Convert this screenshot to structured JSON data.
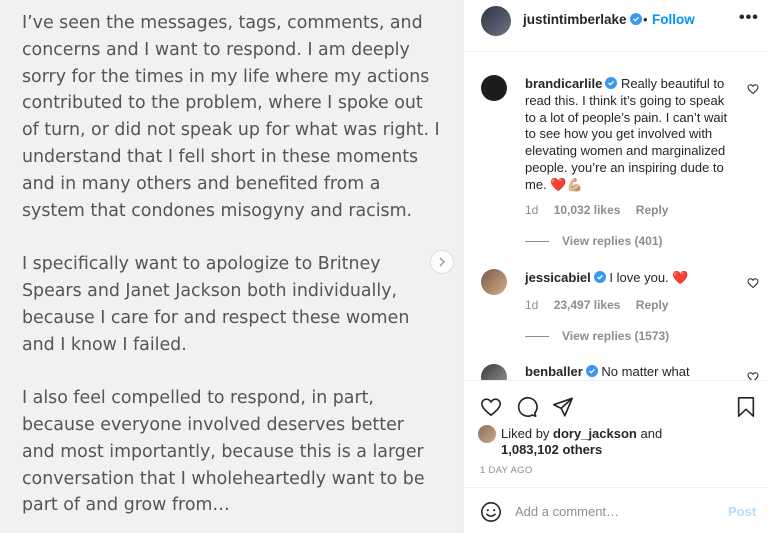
{
  "post": {
    "paragraphs": [
      "I’ve seen the messages, tags, comments, and concerns and I want to respond. I am deeply sorry for the times in my life where my actions contributed to the problem, where I spoke out of turn, or did not speak up for what was right. I understand that I fell short in these moments and in many others and benefited from a system that condones misogyny and racism.",
      "I specifically want to apologize to Britney Spears and Janet Jackson both individually, because I care for and respect these women and I know I failed.",
      "I also feel compelled to respond, in part, because everyone involved deserves better and most importantly, because this is a larger conversation that I wholeheartedly want to be part of and grow from…"
    ]
  },
  "header": {
    "username": "justintimberlake",
    "separator": "•",
    "follow_label": "Follow",
    "more_label": "•••"
  },
  "comments": [
    {
      "username": "brandicarlile",
      "text": "Really beautiful to read this. I think it’s going to speak to a lot of people’s pain. I can’t wait to see how you get involved with elevating women and marginalized people. you’re an inspiring dude to me. ❤️💪🏼",
      "age": "1d",
      "likes": "10,032 likes",
      "reply": "Reply",
      "view_replies": "View replies (401)"
    },
    {
      "username": "jessicabiel",
      "text": "I love you. ❤️",
      "age": "1d",
      "likes": "23,497 likes",
      "reply": "Reply",
      "view_replies": "View replies (1573)"
    },
    {
      "username": "benballer",
      "text": "No matter what"
    }
  ],
  "likes": {
    "prefix": "Liked by",
    "user": "dory_jackson",
    "conj": "and",
    "others": "1,083,102 others"
  },
  "timestamp": "1 DAY AGO",
  "comment_box": {
    "placeholder": "Add a comment…",
    "post_label": "Post"
  },
  "colors": {
    "link_blue": "#0095f6",
    "verified_blue": "#3897f0",
    "post_disabled": "#b2dffc"
  }
}
